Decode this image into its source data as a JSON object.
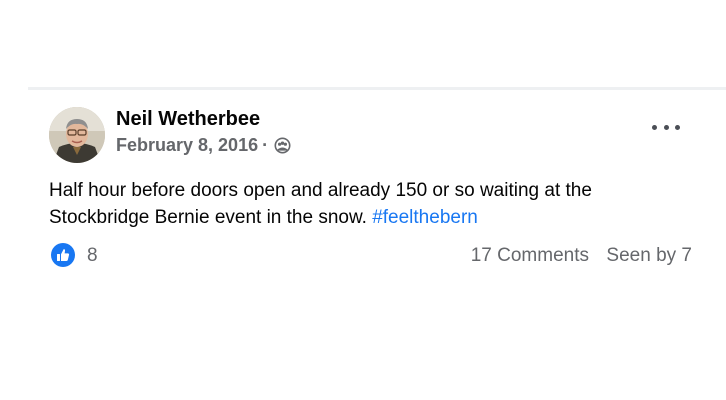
{
  "post": {
    "author": "Neil Wetherbee",
    "date": "February 8, 2016",
    "separator": "·",
    "text_main": "Half hour before doors open and already 150 or so waiting at the Stockbridge Bernie event in the snow. ",
    "hashtag": "#feelthebern",
    "audience_icon": "group-audience-icon",
    "more_icon": "more-options-icon"
  },
  "footer": {
    "reaction_icon": "like-icon",
    "reaction_color": "#1877f2",
    "like_count": "8",
    "comments": "17 Comments",
    "seen_by": "Seen by 7"
  },
  "colors": {
    "text_primary": "#050505",
    "text_secondary": "#65676b",
    "link": "#1877f2"
  }
}
